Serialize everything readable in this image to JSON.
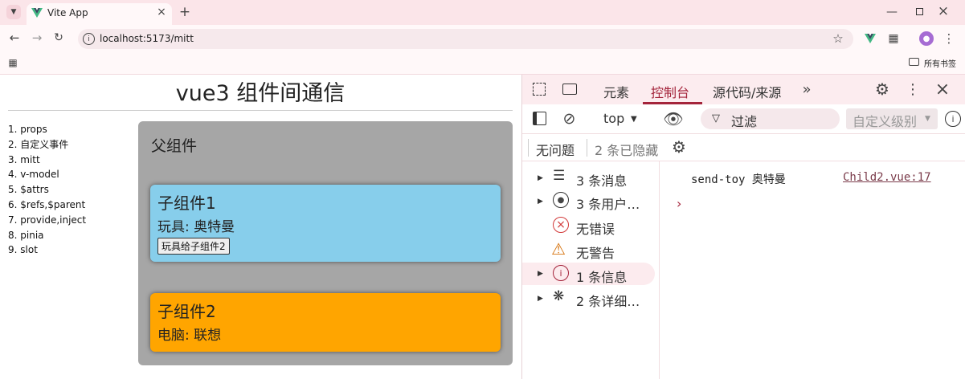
{
  "browser": {
    "tab_title": "Vite App",
    "url": "localhost:5173/mitt",
    "bookmarks_label": "所有书签"
  },
  "page": {
    "title": "vue3 组件间通信",
    "nav": [
      "1. props",
      "2. 自定义事件",
      "3. mitt",
      "4. v-model",
      "5. $attrs",
      "6. $refs,$parent",
      "7. provide,inject",
      "8. pinia",
      "9. slot"
    ],
    "parent": {
      "title": "父组件"
    },
    "child1": {
      "title": "子组件1",
      "toy": "玩具: 奥特曼",
      "button": "玩具给子组件2"
    },
    "child2": {
      "title": "子组件2",
      "computer": "电脑: 联想"
    }
  },
  "devtools": {
    "tabs": {
      "elements": "元素",
      "console": "控制台",
      "sources": "源代码/来源"
    },
    "context": "top",
    "filter_placeholder": "过滤",
    "levels": "自定义级别",
    "issues": "无问题",
    "hidden": "2 条已隐藏",
    "sidebar": [
      "3 条消息",
      "3 条用户…",
      "无错误",
      "无警告",
      "1 条信息",
      "2 条详细…"
    ],
    "log": {
      "text": "send-toy 奥特曼",
      "source": "Child2.vue:17"
    }
  },
  "colors": {
    "child1": "#87ceeb",
    "child2": "#ffa500",
    "parent": "#a6a6a6",
    "accent": "#a4243b"
  }
}
